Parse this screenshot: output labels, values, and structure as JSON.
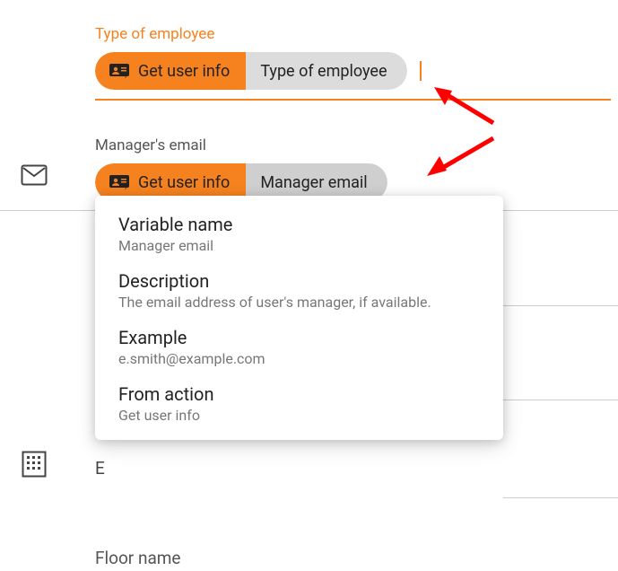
{
  "field1": {
    "label": "Type of employee",
    "pill_action": "Get user info",
    "pill_variable": "Type of employee"
  },
  "field2": {
    "label": "Manager's email",
    "pill_action": "Get user info",
    "pill_variable": "Manager email"
  },
  "popup": {
    "varname_label": "Variable name",
    "varname_value": "Manager email",
    "desc_label": "Description",
    "desc_value": "The email address of user's manager, if available.",
    "example_label": "Example",
    "example_value": "e.smith@example.com",
    "from_label": "From action",
    "from_value": "Get user info"
  },
  "floor_label": "Floor name",
  "colors": {
    "accent": "#f5821f",
    "arrow": "#ff0000"
  }
}
